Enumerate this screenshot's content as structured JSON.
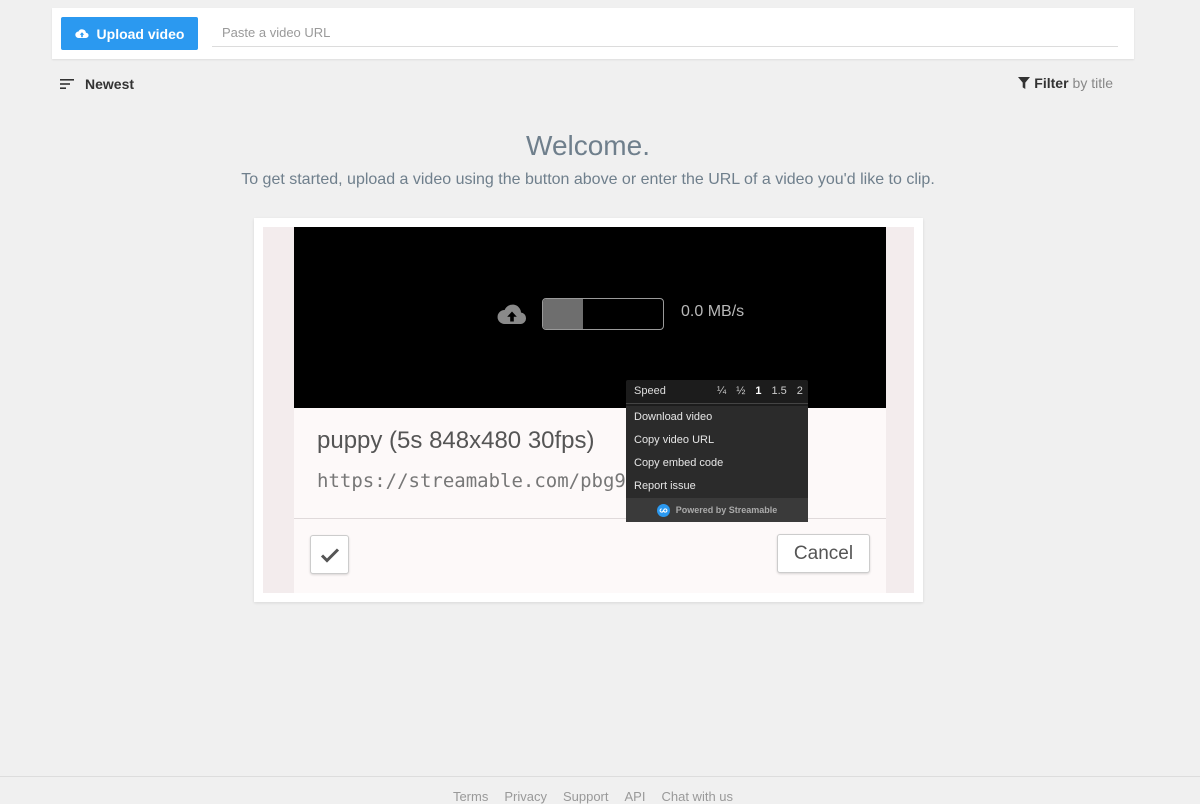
{
  "topbar": {
    "upload_label": "Upload video",
    "url_placeholder": "Paste a video URL"
  },
  "sort": {
    "label": "Newest"
  },
  "filter": {
    "strong": "Filter",
    "muted": "by title"
  },
  "welcome": {
    "title": "Welcome.",
    "subtitle": "To get started, upload a video using the button above or enter the URL of a video you'd like to clip."
  },
  "demo": {
    "upload_speed": "0.0 MB/s",
    "upload_progress": 0.33,
    "clip_title": "puppy (5s 848x480 30fps)",
    "clip_url": "https://streamable.com/pbg98",
    "cancel_label": "Cancel"
  },
  "context_menu": {
    "speed_label": "Speed",
    "speed_options": [
      "¼",
      "½",
      "1",
      "1.5",
      "2"
    ],
    "active_speed": "1",
    "items": [
      "Download video",
      "Copy video URL",
      "Copy embed code",
      "Report issue"
    ],
    "powered_by": "Powered by Streamable"
  },
  "footer": {
    "links": [
      "Terms",
      "Privacy",
      "Support",
      "API",
      "Chat with us"
    ]
  },
  "colors": {
    "accent": "#2b99f0",
    "background": "#f0f0f0",
    "heading": "#6f7f8c"
  }
}
